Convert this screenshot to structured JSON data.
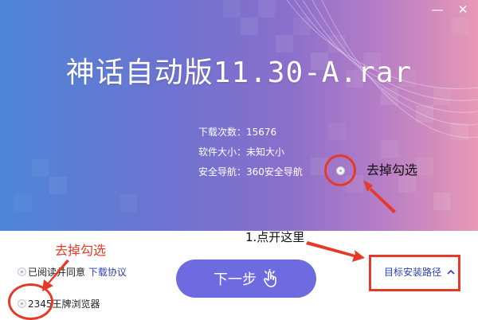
{
  "window": {
    "minimize_label": "—",
    "close_label": "✕"
  },
  "title": "神话自动版11.30-A.rar",
  "info": {
    "downloads_label": "下载次数：",
    "downloads_value": "15676",
    "size_label": "软件大小：",
    "size_value": "未知大小",
    "safety_label": "安全导航：",
    "safety_value": "360安全导航"
  },
  "annotations": {
    "uncheck_right": "去掉勾选",
    "uncheck_left": "去掉勾选",
    "open_here": "1.点开这里"
  },
  "options": {
    "agree_prefix": "已阅读并同意",
    "agree_link": "下载协议",
    "browser_label": "2345王牌浏览器"
  },
  "buttons": {
    "next_label": "下一步",
    "next_icon": "pointer-hand-icon",
    "target_path_label": "目标安装路径",
    "target_path_icon": "chevron-up-icon"
  },
  "colors": {
    "accent": "#6e6ae0",
    "link": "#2d3fb0",
    "annotation_red": "#e53a2a"
  }
}
